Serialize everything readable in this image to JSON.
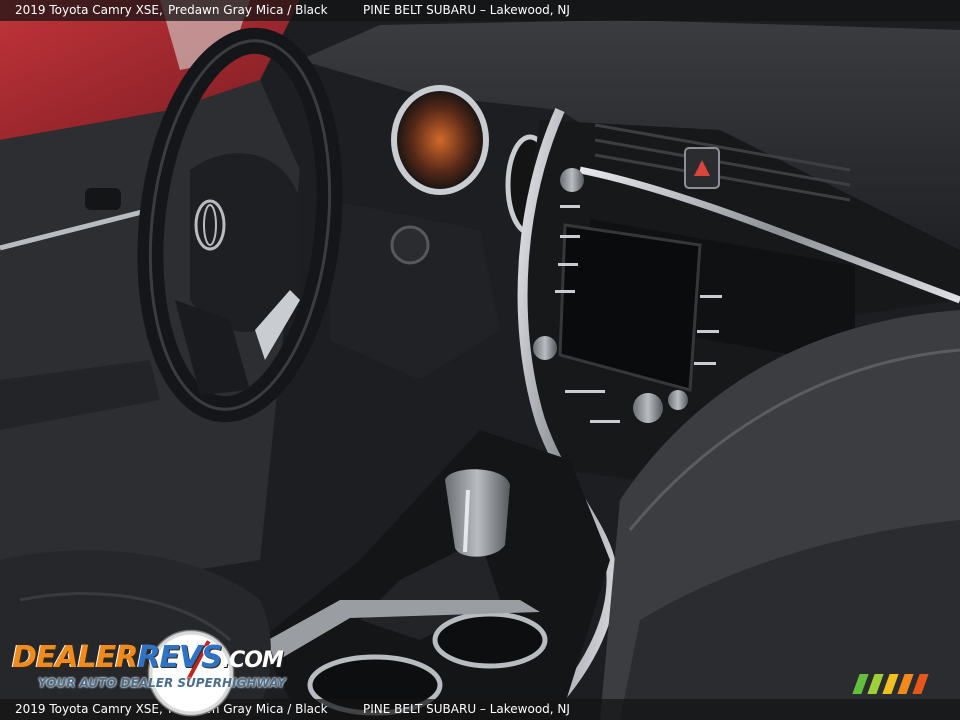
{
  "caption": {
    "vehicle": "2019 Toyota Camry XSE,",
    "color": "Predawn Gray Mica / Black",
    "dealer": "PINE BELT SUBARU – Lakewood, NJ"
  },
  "watermark": {
    "logo_text_orange": "DEALER",
    "logo_text_blue": "REVS",
    "logo_text_suffix": ".COM",
    "tagline": "YOUR AUTO DEALER SUPERHIGHWAY",
    "colors": {
      "orange": "#f08a1c",
      "blue": "#2f73c9"
    }
  },
  "stripe_colors": [
    "#62c03a",
    "#9fd03a",
    "#f0c020",
    "#f08a1c",
    "#e8561c"
  ],
  "photo": {
    "subject": "car-interior-dashboard",
    "colors": {
      "dash": "#2a2c30",
      "chrome": "#c9ccd1",
      "window_red": "#a8262b"
    }
  }
}
